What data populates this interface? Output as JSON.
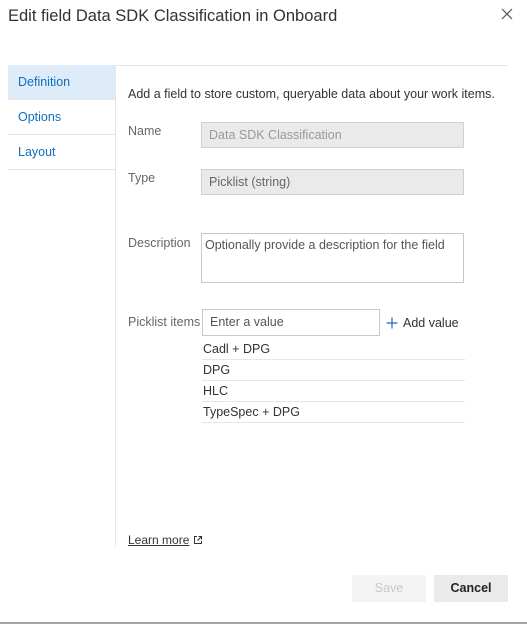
{
  "dialog": {
    "title": "Edit field Data SDK Classification in Onboard"
  },
  "nav": {
    "items": [
      {
        "label": "Definition",
        "active": true
      },
      {
        "label": "Options",
        "active": false
      },
      {
        "label": "Layout",
        "active": false
      }
    ]
  },
  "form": {
    "intro": "Add a field to store custom, queryable data about your work items.",
    "name_label": "Name",
    "name_value": "Data SDK Classification",
    "type_label": "Type",
    "type_value": "Picklist (string)",
    "description_label": "Description",
    "description_placeholder": "Optionally provide a description for the field",
    "picklist_label": "Picklist items",
    "picklist_input_placeholder": "Enter a value",
    "add_value_label": "Add value",
    "picklist_items": [
      "Cadl + DPG",
      "DPG",
      "HLC",
      "TypeSpec + DPG"
    ]
  },
  "footer": {
    "learn_more": "Learn more",
    "save_label": "Save",
    "cancel_label": "Cancel"
  },
  "colors": {
    "accent": "#106ebe",
    "nav_active_bg": "#deecf9"
  },
  "icons": {
    "close": "close-icon",
    "add": "plus-icon",
    "external": "external-link-icon"
  }
}
